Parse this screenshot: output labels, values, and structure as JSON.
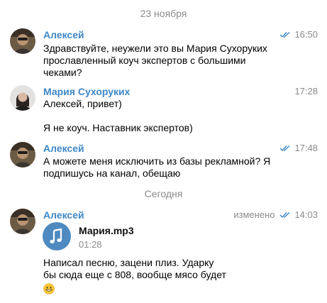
{
  "date_separators": [
    "23 ноября",
    "Сегодня"
  ],
  "colors": {
    "accent": "#3e88c8",
    "muted": "#8a8a8e",
    "audio": "#4e8abf"
  },
  "messages": [
    {
      "sender": "Алексей",
      "time": "16:50",
      "read": true,
      "lines": [
        "Здравствуйте, неужели это вы Мария Сухоруких",
        "прославленный коуч экспертов с большими",
        "чеками?"
      ]
    },
    {
      "sender": "Мария Сухоруких",
      "time": "17:28",
      "read": false,
      "lines": [
        "Алексей, привет)",
        "",
        "Я не коуч. Наставник экспертов)"
      ]
    },
    {
      "sender": "Алексей",
      "time": "17:48",
      "read": true,
      "lines": [
        "А можете меня исключить из базы рекламной? Я",
        "подпишусь на канал, обещаю"
      ]
    },
    {
      "sender": "Алексей",
      "time": "14:03",
      "edited_label": "изменено",
      "read": true,
      "audio": {
        "name": "Мария.mp3",
        "duration": "01:28",
        "icon": "music-note-icon"
      },
      "lines": [
        "Написал песню, зацени плиз. Ударку",
        "бы сюда еще с 808, вообще мясо будет"
      ],
      "emoji": "grinning-face-emoji"
    }
  ]
}
